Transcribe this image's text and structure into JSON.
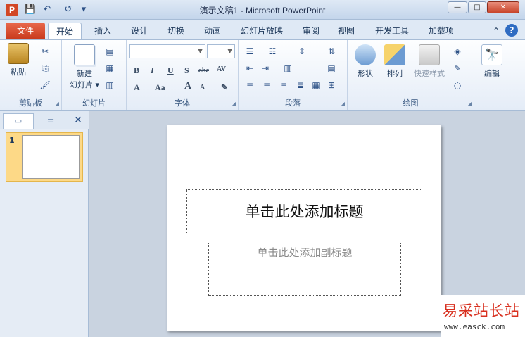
{
  "window": {
    "title": "演示文稿1 - Microsoft PowerPoint",
    "app_icon_letter": "P",
    "controls": {
      "minimize": "—",
      "maximize": "□",
      "close": "✕"
    }
  },
  "quick_access": {
    "save": "💾",
    "undo": "↶",
    "redo": "↺",
    "customize": "▾"
  },
  "tabs": [
    {
      "label": "文件"
    },
    {
      "label": "开始"
    },
    {
      "label": "插入"
    },
    {
      "label": "设计"
    },
    {
      "label": "切换"
    },
    {
      "label": "动画"
    },
    {
      "label": "幻灯片放映"
    },
    {
      "label": "审阅"
    },
    {
      "label": "视图"
    },
    {
      "label": "开发工具"
    },
    {
      "label": "加载项"
    }
  ],
  "tab_extras": {
    "collapse": "⌃",
    "help": "?"
  },
  "ribbon": {
    "clipboard": {
      "label": "剪贴板",
      "paste": "粘贴",
      "cut": "✂",
      "copy": "⎘",
      "format_painter": "🖌"
    },
    "slides": {
      "label": "幻灯片",
      "new_slide_line1": "新建",
      "new_slide_line2": "幻灯片 ▾"
    },
    "font": {
      "label": "字体",
      "bold": "B",
      "italic": "I",
      "underline": "U",
      "shadow": "S",
      "strike": "abc",
      "spacing": "AV",
      "font_color": "A",
      "change_case": "Aa",
      "grow": "A",
      "shrink": "A",
      "clear": "✎"
    },
    "paragraph": {
      "label": "段落"
    },
    "drawing": {
      "label": "绘图",
      "shapes": "形状",
      "arrange": "排列",
      "quick_styles": "快速样式"
    },
    "editing": {
      "label": "编辑",
      "find": "🔭"
    }
  },
  "left_pane": {
    "close": "✕",
    "slide_number": "1"
  },
  "slide": {
    "title_placeholder": "单击此处添加标题",
    "subtitle_placeholder": "单击此处添加副标题"
  },
  "watermark": {
    "site_name": "易采站长站",
    "url": "www.easck.com"
  }
}
